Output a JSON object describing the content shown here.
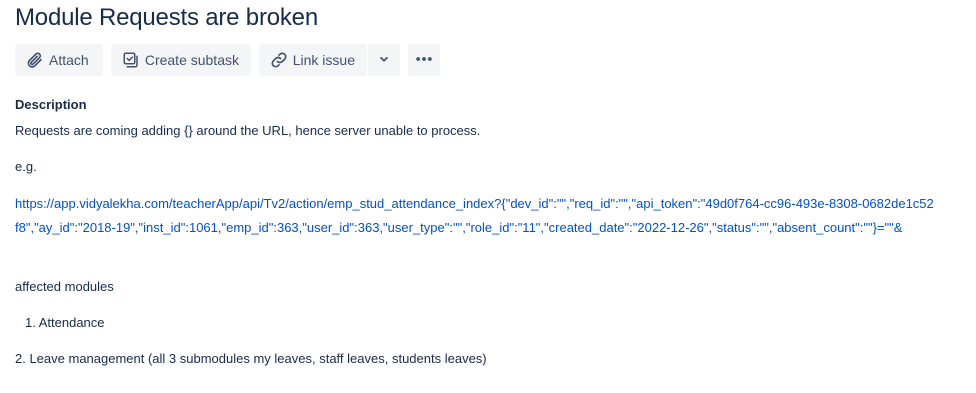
{
  "issue": {
    "title": "Module Requests are broken"
  },
  "toolbar": {
    "attach_label": "Attach",
    "create_subtask_label": "Create subtask",
    "link_issue_label": "Link issue"
  },
  "description": {
    "heading": "Description",
    "line1": "Requests are coming adding {} around the URL, hence server unable to process.",
    "line2": "e.g.",
    "link_text": " https://app.vidyalekha.com/teacherApp/api/Tv2/action/emp_stud_attendance_index?{\"dev_id\":\"\",\"req_id\":\"\",\"api_token\":\"49d0f764-cc96-493e-8308-0682de1c52f8\",\"ay_id\":\"2018-19\",\"inst_id\":1061,\"emp_id\":363,\"user_id\":363,\"user_type\":\"\",\"role_id\":\"11\",\"created_date\":\"2022-12-26\",\"status\":\"\",\"absent_count\":\"\"}=\"\"&",
    "line3": "affected modules",
    "list_item1": "1. Attendance",
    "line4": "2. Leave management (all 3 submodules my leaves, staff leaves, students leaves)"
  },
  "colors": {
    "text": "#172b4d",
    "link": "#0052cc",
    "button_bg": "#f4f5f7",
    "button_text": "#42526e"
  }
}
